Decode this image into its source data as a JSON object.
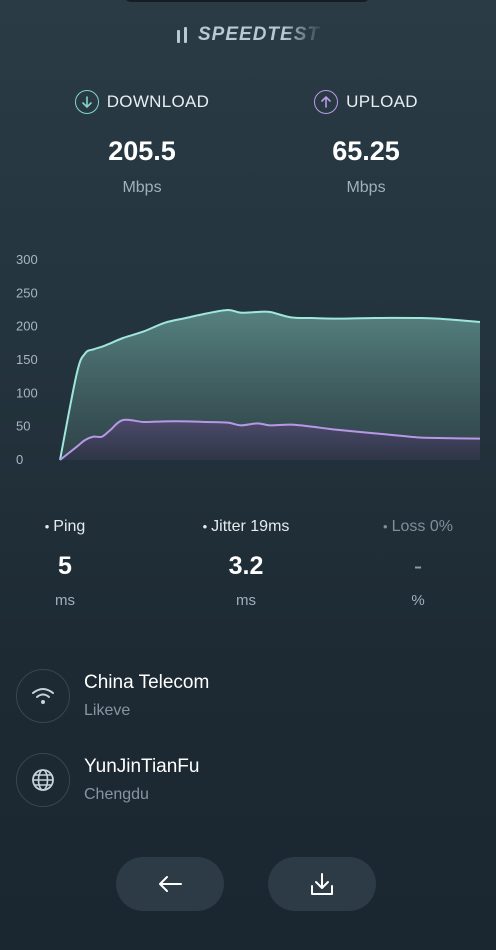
{
  "brand": {
    "name": "SPEEDTEST"
  },
  "download": {
    "label": "DOWNLOAD",
    "value": "205.5",
    "unit": "Mbps"
  },
  "upload": {
    "label": "UPLOAD",
    "value": "65.25",
    "unit": "Mbps"
  },
  "chart_data": {
    "type": "area",
    "ylim": [
      0,
      300
    ],
    "yticks": [
      "300",
      "250",
      "200",
      "150",
      "100",
      "50",
      "0"
    ],
    "x": [
      0,
      4,
      6,
      8,
      10,
      12,
      15,
      20,
      25,
      30,
      35,
      40,
      43,
      47,
      50,
      55,
      60,
      65,
      75,
      85,
      90,
      100
    ],
    "series": [
      {
        "name": "DOWNLOAD",
        "color": "#9fe6dc",
        "values": [
          0,
          130,
          160,
          166,
          170,
          175,
          183,
          193,
          206,
          213,
          220,
          225,
          221,
          222,
          222,
          214,
          213,
          212,
          213,
          213,
          212,
          207
        ]
      },
      {
        "name": "UPLOAD",
        "color": "#b898e6",
        "values": [
          0,
          20,
          30,
          35,
          35,
          45,
          60,
          57,
          58,
          58,
          57,
          56,
          52,
          55,
          52,
          53,
          50,
          46,
          40,
          34,
          33,
          32
        ]
      }
    ]
  },
  "ping": {
    "label": "Ping",
    "value": "5",
    "unit": "ms"
  },
  "jitter": {
    "label": "Jitter 19ms",
    "value": "3.2",
    "unit": "ms"
  },
  "loss": {
    "label": "Loss 0%",
    "value": "-",
    "unit": "%"
  },
  "isp": {
    "name": "China Telecom",
    "sub": "Likeve"
  },
  "server": {
    "name": "YunJinTianFu",
    "sub": "Chengdu"
  },
  "icons": {
    "brand": "speedtest-logo-icon",
    "download": "arrow-down-icon",
    "upload": "arrow-up-icon",
    "isp": "wifi-icon",
    "server": "globe-icon",
    "back": "arrow-left-icon",
    "save": "download-tray-icon"
  }
}
